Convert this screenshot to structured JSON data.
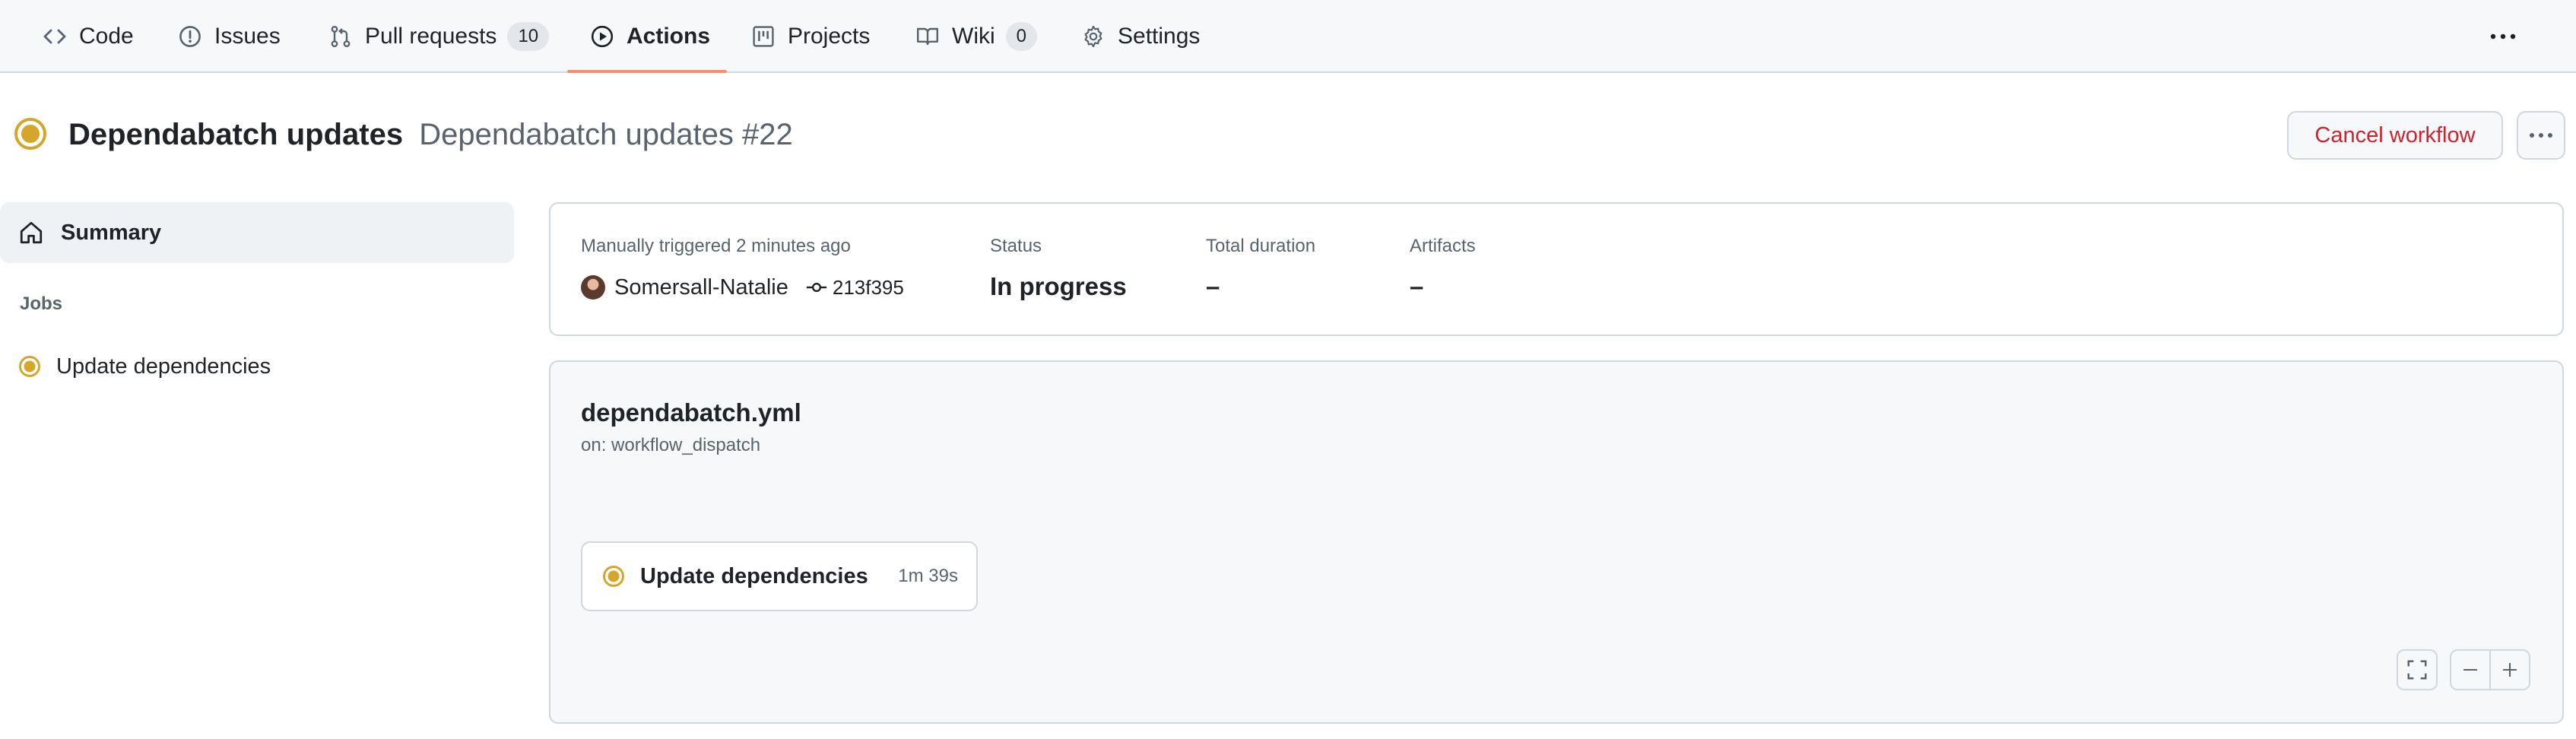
{
  "nav": {
    "tabs": [
      {
        "label": "Code",
        "icon": "code-icon"
      },
      {
        "label": "Issues",
        "icon": "issue-icon"
      },
      {
        "label": "Pull requests",
        "icon": "pull-request-icon",
        "counter": "10"
      },
      {
        "label": "Actions",
        "icon": "play-icon",
        "active": true
      },
      {
        "label": "Projects",
        "icon": "project-icon"
      },
      {
        "label": "Wiki",
        "icon": "book-icon",
        "counter": "0"
      },
      {
        "label": "Settings",
        "icon": "gear-icon"
      }
    ],
    "more_icon": "kebab-horizontal-icon"
  },
  "header": {
    "workflow_name": "Dependabatch updates",
    "run_name": "Dependabatch updates #22",
    "status_icon": "in-progress-icon",
    "cancel_label": "Cancel workflow",
    "more_icon": "kebab-horizontal-icon"
  },
  "sidebar": {
    "summary_label": "Summary",
    "summary_icon": "home-icon",
    "jobs_heading": "Jobs",
    "jobs": [
      {
        "label": "Update dependencies",
        "status_icon": "in-progress-icon"
      }
    ]
  },
  "summary": {
    "trigger_text": "Manually triggered 2 minutes ago",
    "actor": "Somersall-Natalie",
    "commit": "213f395",
    "status_label": "Status",
    "status_value": "In progress",
    "duration_label": "Total duration",
    "duration_value": "–",
    "artifacts_label": "Artifacts",
    "artifacts_value": "–"
  },
  "graph": {
    "file_name": "dependabatch.yml",
    "trigger": "on: workflow_dispatch",
    "job": {
      "label": "Update dependencies",
      "duration": "1m 39s",
      "status_icon": "in-progress-icon"
    },
    "controls": [
      "fullscreen-icon",
      "zoom-out-icon",
      "zoom-in-icon"
    ]
  },
  "colors": {
    "accent_underline": "#fd8c73",
    "in_progress": "#d4a72c",
    "danger": "#cf222e",
    "muted_text": "#59636e",
    "border": "#d0d7de"
  }
}
